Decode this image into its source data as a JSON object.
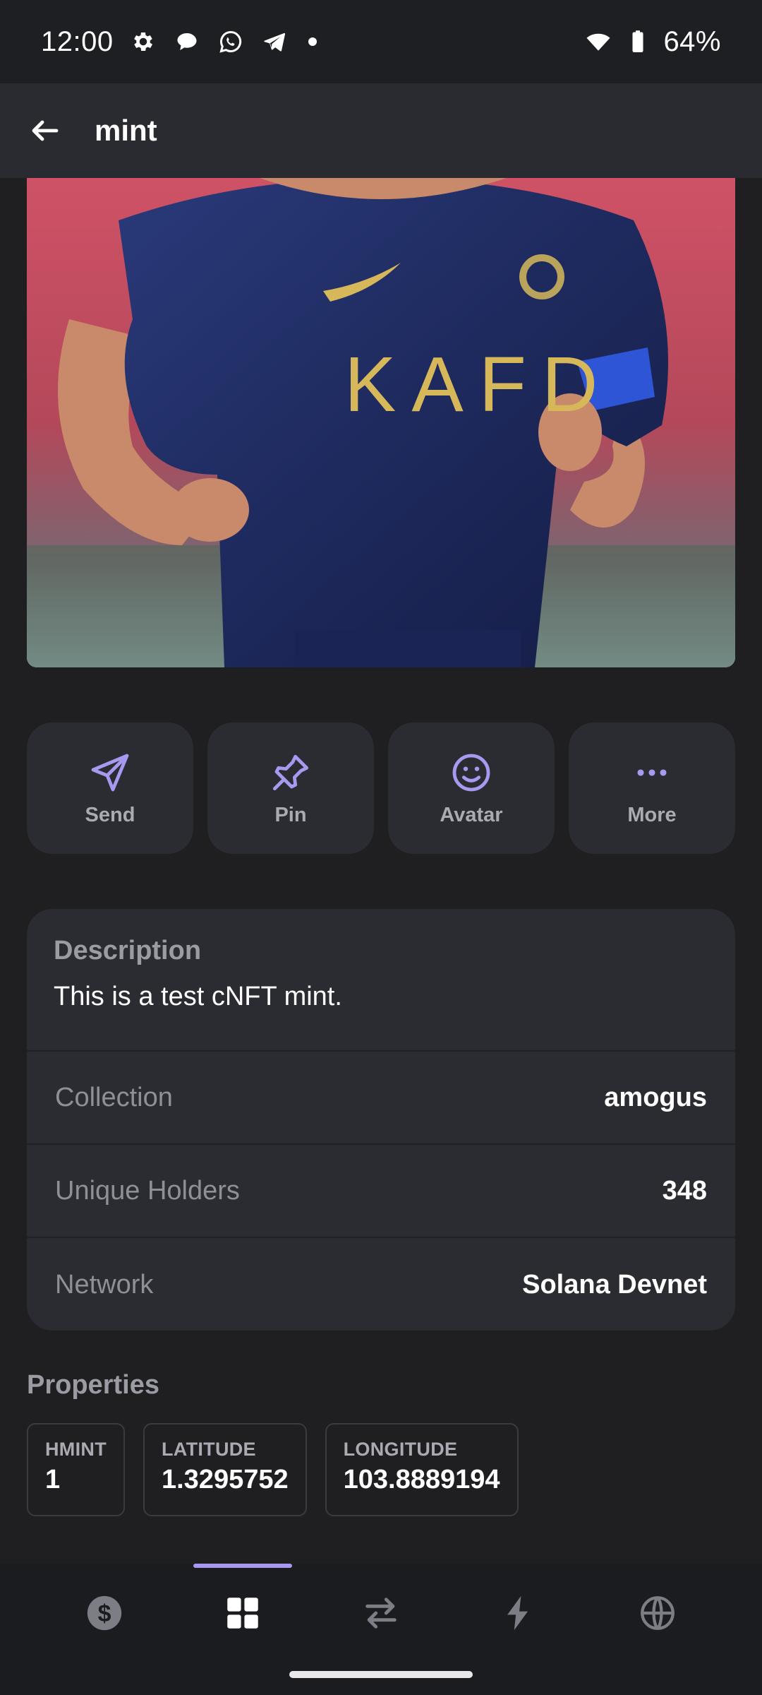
{
  "status_bar": {
    "time": "12:00",
    "battery_percent": "64%"
  },
  "app_bar": {
    "title": "mint"
  },
  "hero": {
    "image_text": "KAFD"
  },
  "actions": [
    {
      "label": "Send",
      "icon": "send-icon"
    },
    {
      "label": "Pin",
      "icon": "pin-icon"
    },
    {
      "label": "Avatar",
      "icon": "smiley-icon"
    },
    {
      "label": "More",
      "icon": "more-dots-icon"
    }
  ],
  "info": {
    "description_title": "Description",
    "description_text": "This is a test cNFT mint.",
    "rows": [
      {
        "label": "Collection",
        "value": "amogus"
      },
      {
        "label": "Unique Holders",
        "value": "348"
      },
      {
        "label": "Network",
        "value": "Solana Devnet"
      }
    ]
  },
  "properties": {
    "title": "Properties",
    "items": [
      {
        "key": "HMINT",
        "value": "1"
      },
      {
        "key": "LATITUDE",
        "value": "1.3295752"
      },
      {
        "key": "LONGITUDE",
        "value": "103.8889194"
      }
    ]
  },
  "bottom_nav": {
    "items": [
      {
        "name": "balance",
        "icon": "dollar-icon"
      },
      {
        "name": "collectibles",
        "icon": "grid-icon",
        "active": true
      },
      {
        "name": "swap",
        "icon": "swap-arrows-icon"
      },
      {
        "name": "activity",
        "icon": "lightning-icon"
      },
      {
        "name": "browser",
        "icon": "globe-icon"
      }
    ]
  },
  "colors": {
    "accent": "#a899f0",
    "background": "#1f1f22",
    "card": "#2b2c32"
  }
}
